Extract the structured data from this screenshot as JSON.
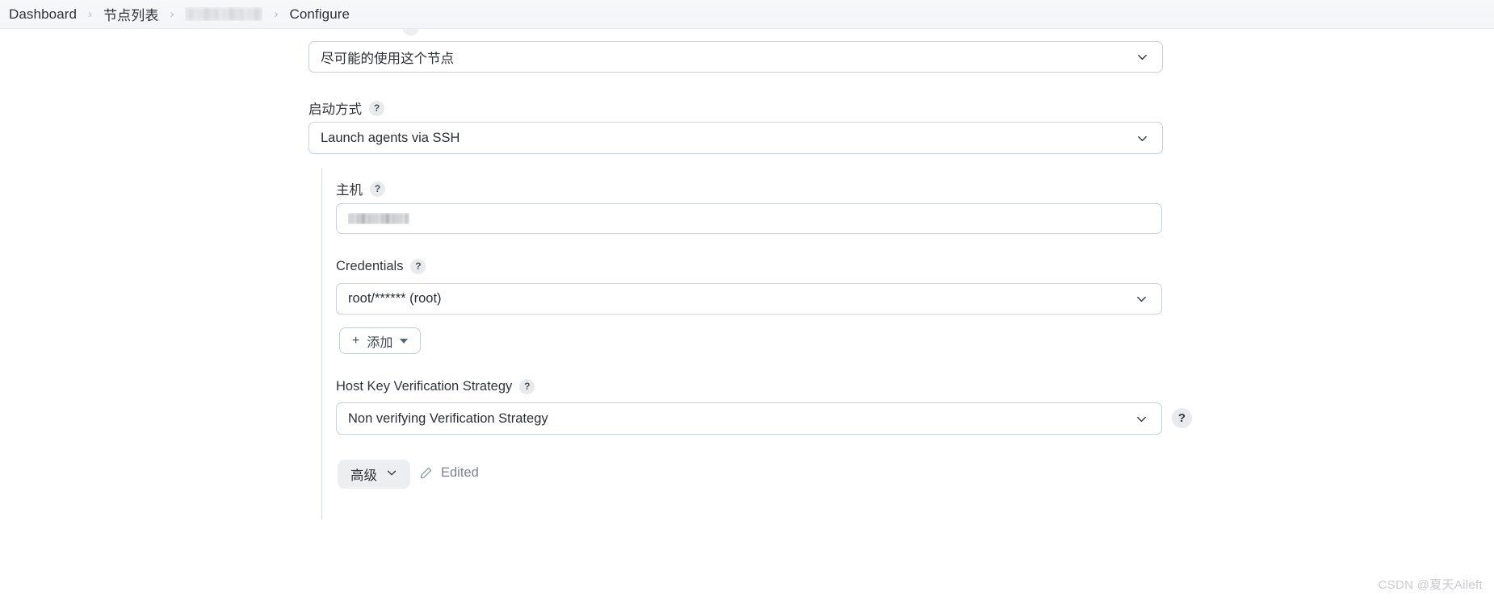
{
  "breadcrumb": {
    "items": [
      {
        "label": "Dashboard",
        "type": "link"
      },
      {
        "label": "节点列表",
        "type": "link"
      },
      {
        "label": "",
        "type": "redacted"
      },
      {
        "label": "Configure",
        "type": "current"
      }
    ],
    "separator": "›"
  },
  "form": {
    "usage_select": {
      "value": "尽可能的使用这个节点",
      "icon": "chevron-down-icon"
    },
    "launch_method": {
      "label": "启动方式",
      "help": "?",
      "value": "Launch agents via SSH",
      "icon": "chevron-down-icon"
    },
    "host": {
      "label": "主机",
      "help": "?",
      "value": "",
      "redacted": true
    },
    "credentials": {
      "label": "Credentials",
      "help": "?",
      "value": "root/****** (root)",
      "icon": "chevron-down-icon",
      "add_button": {
        "plus": "+",
        "label": "添加",
        "caret": "caret-down-icon"
      }
    },
    "host_key_strategy": {
      "label": "Host Key Verification Strategy",
      "help": "?",
      "value": "Non verifying Verification Strategy",
      "icon": "chevron-down-icon",
      "side_help": "?"
    },
    "footer": {
      "advanced_label": "高级",
      "advanced_icon": "chevron-down-icon",
      "edited_label": "Edited",
      "edited_icon": "pencil-icon"
    }
  },
  "watermark": "CSDN @夏天Aileft",
  "colors": {
    "page_background": "#ffffff",
    "header_background": "#f5f6f7",
    "field_border": "#ccd3d9",
    "text_primary": "#2b2f34",
    "text_muted": "#7d838c",
    "help_badge_background": "#e9eaec",
    "advanced_button_background": "#eceef0"
  }
}
